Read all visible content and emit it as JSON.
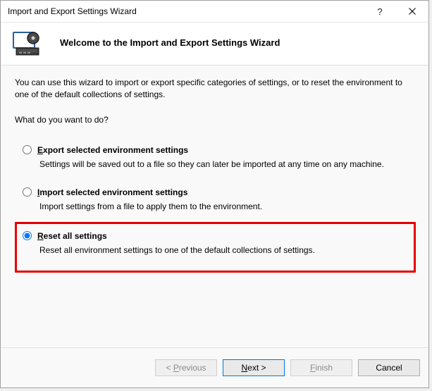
{
  "window": {
    "title": "Import and Export Settings Wizard"
  },
  "header": {
    "welcome": "Welcome to the Import and Export Settings Wizard"
  },
  "body": {
    "intro": "You can use this wizard to import or export specific categories of settings, or to reset the environment to one of the default collections of settings.",
    "prompt": "What do you want to do?",
    "options": [
      {
        "key": "export",
        "accel": "E",
        "rest": "xport selected environment settings",
        "desc": "Settings will be saved out to a file so they can later be imported at any time on any machine.",
        "selected": false
      },
      {
        "key": "import",
        "accel": "I",
        "rest": "mport selected environment settings",
        "desc": "Import settings from a file to apply them to the environment.",
        "selected": false
      },
      {
        "key": "reset",
        "accel": "R",
        "rest": "eset all settings",
        "desc": "Reset all environment settings to one of the default collections of settings.",
        "selected": true
      }
    ]
  },
  "footer": {
    "previous_pre": "< ",
    "previous_accel": "P",
    "previous_rest": "revious",
    "next_accel": "N",
    "next_rest": "ext >",
    "finish_accel": "F",
    "finish_rest": "inish",
    "cancel": "Cancel"
  }
}
